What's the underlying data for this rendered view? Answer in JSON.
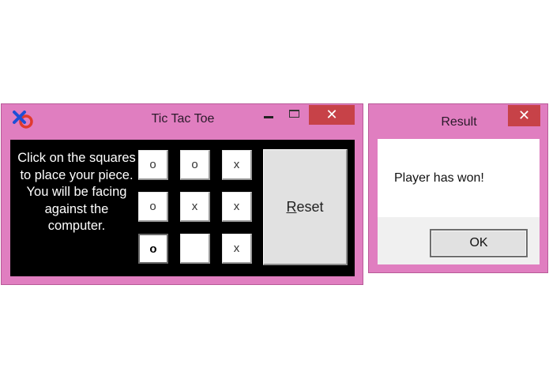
{
  "game_window": {
    "title": "Tic Tac Toe",
    "close_glyph": "✕",
    "instructions": "Click on the squares to place your piece. You will be facing against the computer.",
    "board": [
      [
        "o",
        "o",
        "x"
      ],
      [
        "o",
        "x",
        "x"
      ],
      [
        "o",
        "",
        "x"
      ]
    ],
    "reset_label_mnemonic": "R",
    "reset_label_rest": "eset",
    "icons": {
      "app": "tic-tac-toe-app-icon",
      "minimize": "minimize-icon",
      "maximize": "maximize-icon",
      "close": "close-icon"
    },
    "colors": {
      "frame": "#e07ec0",
      "close": "#c74248",
      "client": "#000000"
    }
  },
  "result_dialog": {
    "title": "Result",
    "close_glyph": "✕",
    "message": "Player has won!",
    "ok_label": "OK"
  }
}
